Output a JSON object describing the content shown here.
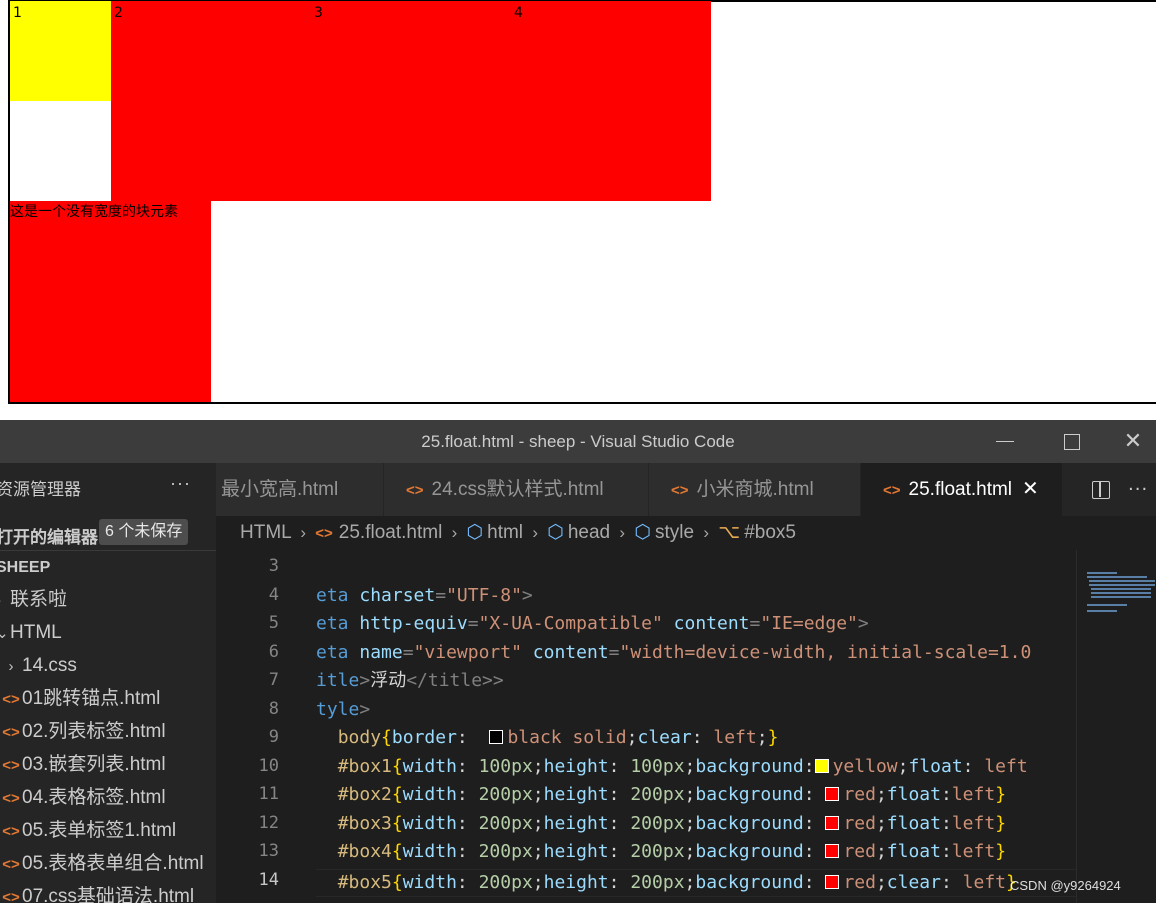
{
  "preview": {
    "box1": "1",
    "box2": "2",
    "box3": "3",
    "box4": "4",
    "box5": "这是一个没有宽度的块元素"
  },
  "window": {
    "title": "25.float.html - sheep - Visual Studio Code",
    "close_glyph": "✕"
  },
  "sidebar": {
    "header": "资源管理器",
    "more": "···",
    "open_editors": "打开的编辑器",
    "unsaved_badge": "6 个未保存",
    "items": [
      {
        "label": "SHEEP",
        "chev": ""
      },
      {
        "label": "联系啦",
        "chev": "›"
      },
      {
        "label": "HTML",
        "chev": "⌄"
      },
      {
        "label": "14.css",
        "icon": "›"
      },
      {
        "label": "01跳转锚点.html",
        "icon": "<>"
      },
      {
        "label": "02.列表标签.html",
        "icon": "<>"
      },
      {
        "label": "03.嵌套列表.html",
        "icon": "<>"
      },
      {
        "label": "04.表格标签.html",
        "icon": "<>"
      },
      {
        "label": "05.表单标签1.html",
        "icon": "<>"
      },
      {
        "label": "05.表格表单组合.html",
        "icon": "<>"
      },
      {
        "label": "07.css基础语法.html",
        "icon": "<>"
      }
    ]
  },
  "tabs": [
    {
      "label": "最小宽高.html",
      "icon": ""
    },
    {
      "label": "24.css默认样式.html",
      "icon": "<>"
    },
    {
      "label": "小米商城.html",
      "icon": "<>"
    },
    {
      "label": "25.float.html",
      "icon": "<>",
      "close": "✕"
    }
  ],
  "tab_actions": {
    "more": "···"
  },
  "breadcrumb": {
    "items": [
      "HTML",
      "25.float.html",
      "html",
      "head",
      "style",
      "#box5"
    ],
    "sep": "›",
    "html_icon": "<>"
  },
  "gutter": {
    "lines": [
      "3",
      "4",
      "5",
      "6",
      "7",
      "8",
      "9",
      "10",
      "11",
      "12",
      "13",
      "14"
    ]
  },
  "code": {
    "l4": {
      "tag": "eta",
      "attr": "charset",
      "val": "\"UTF-8\""
    },
    "l5": {
      "tag": "eta",
      "attr1": "http-equiv",
      "val1": "\"X-UA-Compatible\"",
      "attr2": "content",
      "val2": "\"IE=edge\""
    },
    "l6": {
      "tag": "eta",
      "attr1": "name",
      "val1": "\"viewport\"",
      "attr2": "content",
      "val2": "\"width=device-width, initial-scale=1.0"
    },
    "l7": {
      "tag": "itle",
      "text": "浮动",
      "close": "</title>"
    },
    "l8": {
      "tag": "tyle"
    },
    "l9": {
      "sel": "body",
      "p1": "border",
      "v1": "black solid",
      "p2": "clear",
      "v2": "left"
    },
    "l10": {
      "sel": "#box1",
      "p1": "width",
      "n1": "100px",
      "p2": "height",
      "n2": "100px",
      "p3": "background",
      "v3": "yellow",
      "p4": "float",
      "v4": "left"
    },
    "l11": {
      "sel": "#box2",
      "p1": "width",
      "n1": "200px",
      "p2": "height",
      "n2": "200px",
      "p3": "background",
      "v3": "red",
      "p4": "float",
      "v4": "left"
    },
    "l12": {
      "sel": "#box3",
      "p1": "width",
      "n1": "200px",
      "p2": "height",
      "n2": "200px",
      "p3": "background",
      "v3": "red",
      "p4": "float",
      "v4": "left"
    },
    "l13": {
      "sel": "#box4",
      "p1": "width",
      "n1": "200px",
      "p2": "height",
      "n2": "200px",
      "p3": "background",
      "v3": "red",
      "p4": "float",
      "v4": "left"
    },
    "l14": {
      "sel": "#box5",
      "p1": "width",
      "n1": "200px",
      "p2": "height",
      "n2": "200px",
      "p3": "background",
      "v3": "red",
      "p4": "clear",
      "v4": "left"
    }
  },
  "watermark": "CSDN @y9264924",
  "colors": {
    "yellow_box": "#ffff00",
    "red_box": "#ff0000",
    "editor_bg": "#1e1e1e",
    "sidebar_bg": "#252526",
    "titlebar_bg": "#3c3c3c"
  }
}
